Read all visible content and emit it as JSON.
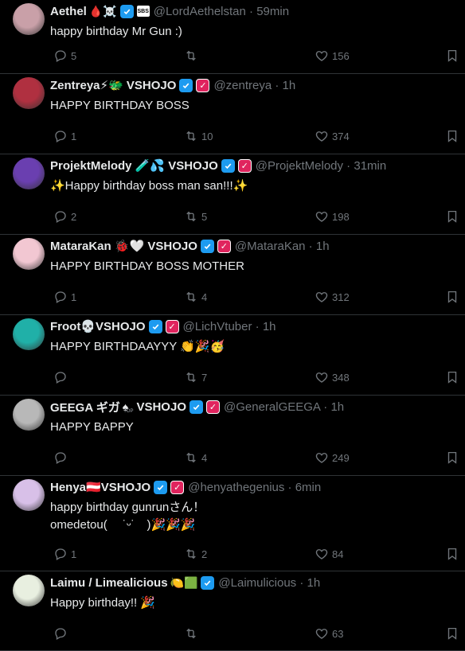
{
  "tweets": [
    {
      "name": "Aethel",
      "deco": "🩸☠️",
      "badges": [
        "verified",
        "box"
      ],
      "box_label": "SBS",
      "handle": "@LordAethelstan",
      "time": "59min",
      "text": "happy birthday Mr Gun :)",
      "replies": "5",
      "retweets": "",
      "likes": "156",
      "avatar_color": "#c9a0a8"
    },
    {
      "name": "Zentreya⚡🐲 VSHOJO",
      "deco": "",
      "badges": [
        "verified",
        "vs"
      ],
      "handle": "@zentreya",
      "time": "1h",
      "text": "HAPPY BIRTHDAY BOSS",
      "replies": "1",
      "retweets": "10",
      "likes": "374",
      "avatar_color": "#b03040"
    },
    {
      "name": "ProjektMelody 🧪💦 VSHOJO",
      "deco": "",
      "badges": [
        "verified",
        "vs"
      ],
      "handle": "@ProjektMelody",
      "time": "31min",
      "text": "✨Happy birthday boss man san!!!✨",
      "replies": "2",
      "retweets": "5",
      "likes": "198",
      "avatar_color": "#6a3fb0"
    },
    {
      "name": "MataraKan 🐞🤍 VSHOJO",
      "deco": "",
      "badges": [
        "verified",
        "vs"
      ],
      "handle": "@MataraKan",
      "time": "1h",
      "text": "HAPPY BIRTHDAY BOSS MOTHER",
      "replies": "1",
      "retweets": "4",
      "likes": "312",
      "avatar_color": "#f2c7d2"
    },
    {
      "name": "Froot💀VSHOJO",
      "deco": "",
      "badges": [
        "verified",
        "vs"
      ],
      "handle": "@LichVtuber",
      "time": "1h",
      "text": "HAPPY BIRTHDAAYYY 👏🎉🥳",
      "replies": "",
      "retweets": "7",
      "likes": "348",
      "avatar_color": "#20b0a8"
    },
    {
      "name": "GEEGA ギガ",
      "deco": "♠",
      "deco_label": "TOP",
      "name_suffix": "VSHOJO",
      "badges": [
        "verified",
        "vs"
      ],
      "handle": "@GeneralGEEGA",
      "time": "1h",
      "text": "HAPPY BAPPY",
      "replies": "",
      "retweets": "4",
      "likes": "249",
      "avatar_color": "#b8b8b8"
    },
    {
      "name": "Henya🇦🇹VSHOJO",
      "deco": "",
      "badges": [
        "verified",
        "vs"
      ],
      "handle": "@henyathegenius",
      "time": "6min",
      "text": "happy birthday gunrunさん！\nomedetou(　 ˙ᵕ˙　)🎉🎉🎉",
      "replies": "1",
      "retweets": "2",
      "likes": "84",
      "avatar_color": "#d8c0e8"
    },
    {
      "name": "Laimu / Limealicious",
      "deco": "🍋🟩",
      "badges": [
        "verified"
      ],
      "handle": "@Laimulicious",
      "time": "1h",
      "text": "Happy birthday!! 🎉",
      "replies": "",
      "retweets": "",
      "likes": "63",
      "avatar_color": "#e8efe0"
    }
  ]
}
